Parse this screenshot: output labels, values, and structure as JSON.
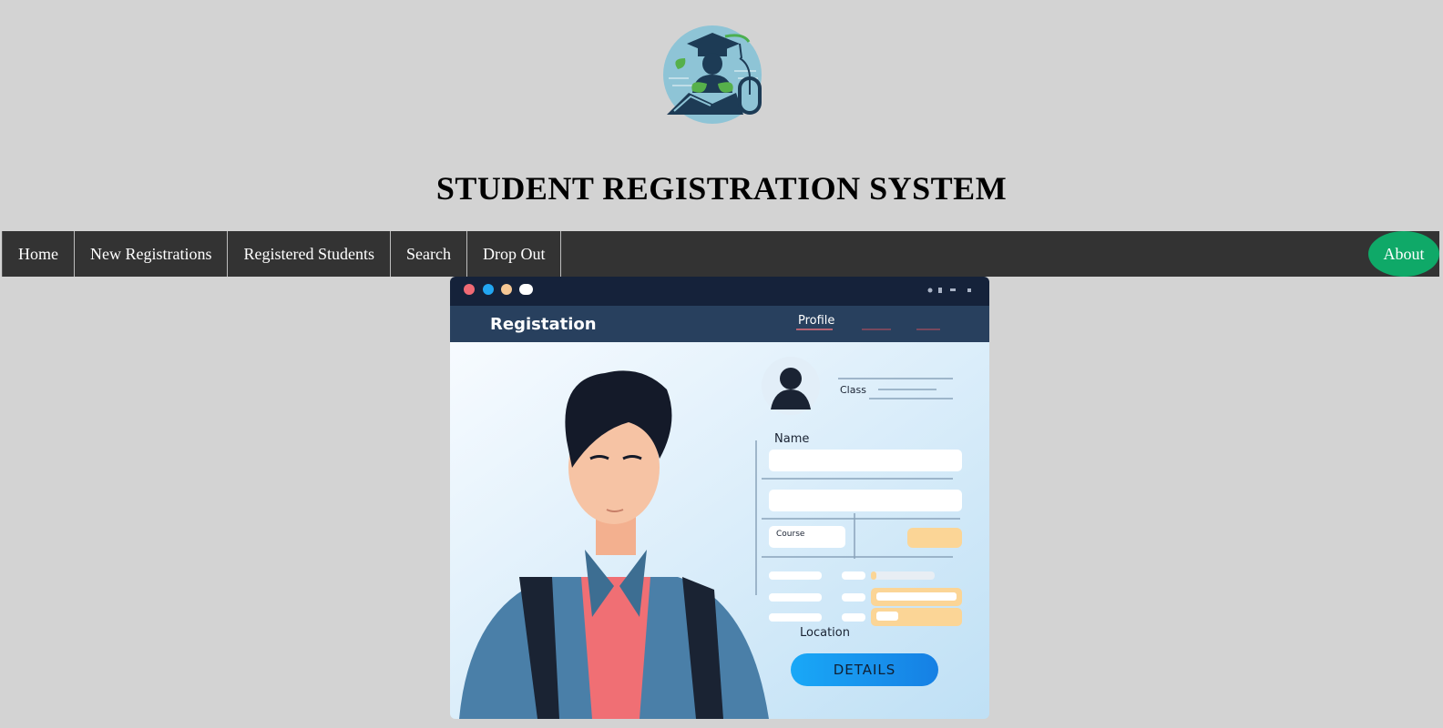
{
  "header": {
    "title": "STUDENT REGISTRATION SYSTEM",
    "logo_icon": "graduate-mouse-logo"
  },
  "nav": {
    "items": [
      {
        "label": "Home"
      },
      {
        "label": "New Registrations"
      },
      {
        "label": "Registered Students"
      },
      {
        "label": "Search"
      },
      {
        "label": "Drop Out"
      }
    ],
    "about_label": "About"
  },
  "hero": {
    "app_title": "Registation",
    "tab_profile": "Profile",
    "label_class": "Class",
    "label_name": "Name",
    "label_course": "Course",
    "label_location": "Location",
    "details_button": "DETAILS"
  },
  "colors": {
    "page_bg": "#d3d3d3",
    "nav_bg": "#333333",
    "about_bg": "#0fa968",
    "details_bg": "#1a9cf0"
  }
}
